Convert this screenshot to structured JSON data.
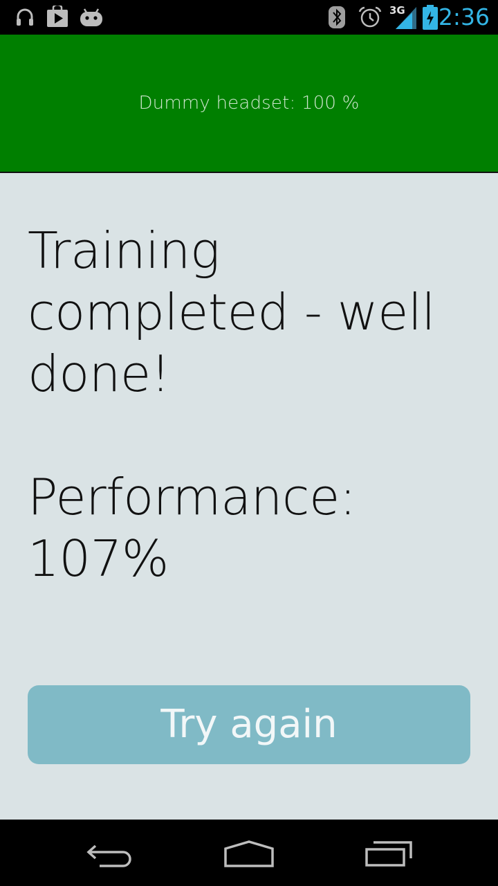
{
  "status_bar": {
    "time": "2:36",
    "network_label": "3G",
    "icons": [
      "headphones-icon",
      "play-store-icon",
      "android-icon",
      "bluetooth-icon",
      "alarm-icon",
      "signal-icon",
      "battery-charging-icon"
    ],
    "time_color": "#33b5e5"
  },
  "header": {
    "text": "Dummy headset: 100 %",
    "background": "#007f00"
  },
  "main": {
    "title_line1": "Training",
    "title_line2": "completed - well",
    "title_line3": "done!",
    "performance_label": "Performance:",
    "performance_value": "107%"
  },
  "button": {
    "label": "Try again",
    "color": "#80bac6"
  },
  "nav_bar": {
    "icons": [
      "back-icon",
      "home-icon",
      "recent-apps-icon"
    ]
  },
  "colors": {
    "background": "#dae3e5"
  }
}
